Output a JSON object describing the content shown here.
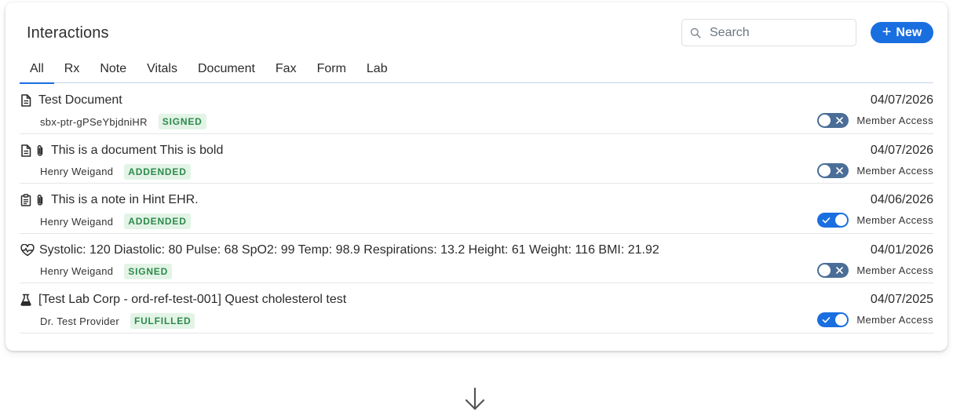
{
  "header": {
    "title": "Interactions",
    "search_placeholder": "Search",
    "new_label": "New"
  },
  "tabs": [
    {
      "label": "All",
      "active": true
    },
    {
      "label": "Rx",
      "active": false
    },
    {
      "label": "Note",
      "active": false
    },
    {
      "label": "Vitals",
      "active": false
    },
    {
      "label": "Document",
      "active": false
    },
    {
      "label": "Fax",
      "active": false
    },
    {
      "label": "Form",
      "active": false
    },
    {
      "label": "Lab",
      "active": false
    }
  ],
  "rows": [
    {
      "type_icon": "document-icon",
      "attachment": false,
      "title": "Test Document",
      "date": "04/07/2026",
      "author": "sbx-ptr-gPSeYbjdniHR",
      "status": "SIGNED",
      "member_access": false,
      "access_label": "Member Access"
    },
    {
      "type_icon": "document-icon",
      "attachment": true,
      "title": "This is a document This is bold",
      "date": "04/07/2026",
      "author": "Henry Weigand",
      "status": "ADDENDED",
      "member_access": false,
      "access_label": "Member Access"
    },
    {
      "type_icon": "clipboard-icon",
      "attachment": true,
      "title": "This is a note in Hint EHR.",
      "date": "04/06/2026",
      "author": "Henry Weigand",
      "status": "ADDENDED",
      "member_access": true,
      "access_label": "Member Access"
    },
    {
      "type_icon": "heart-pulse-icon",
      "attachment": false,
      "title": "Systolic: 120 Diastolic: 80 Pulse: 68 SpO2: 99 Temp: 98.9 Respirations: 13.2 Height: 61 Weight: 116 BMI: 21.92",
      "date": "04/01/2026",
      "author": "Henry Weigand",
      "status": "SIGNED",
      "member_access": false,
      "access_label": "Member Access"
    },
    {
      "type_icon": "flask-icon",
      "attachment": false,
      "title": "[Test Lab Corp - ord-ref-test-001] Quest cholesterol test",
      "date": "04/07/2025",
      "author": "Dr. Test Provider",
      "status": "FULFILLED",
      "member_access": true,
      "access_label": "Member Access"
    }
  ],
  "colors": {
    "accent": "#1a6fe0",
    "toggle_off": "#4a6e97",
    "badge_bg": "#e3f4e7",
    "badge_text": "#2c8a4a"
  }
}
